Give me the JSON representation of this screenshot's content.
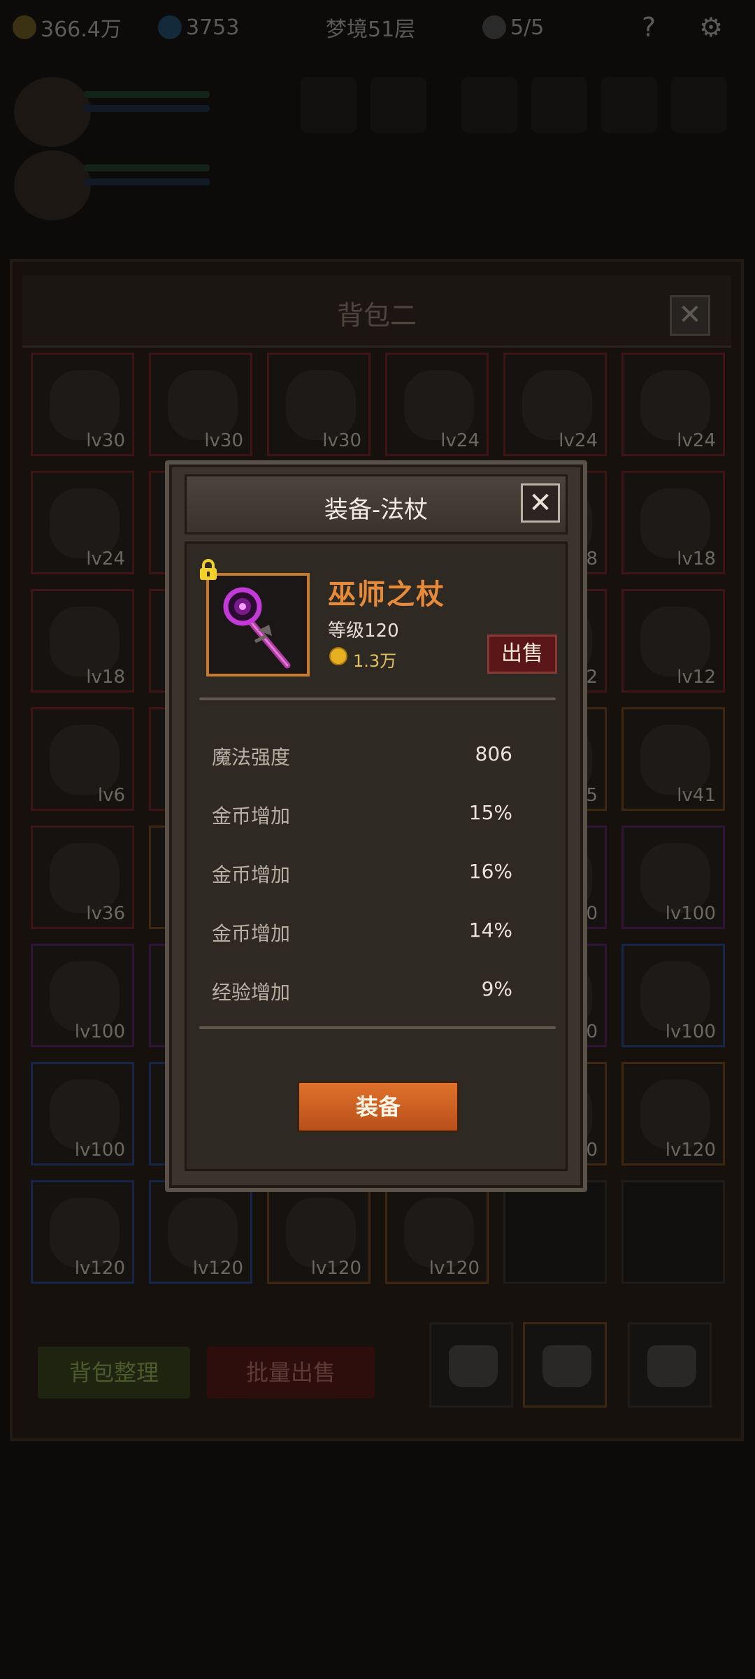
{
  "topbar": {
    "gold": "366.4万",
    "gems": "3753",
    "dream_floor": "梦境51层",
    "keys": "5/5",
    "help_icon": "question-icon",
    "settings_icon": "gear-icon"
  },
  "bag": {
    "title": "背包二",
    "close_label": "✕",
    "items": [
      {
        "level": "lv30",
        "rarity": "red"
      },
      {
        "level": "lv30",
        "rarity": "red"
      },
      {
        "level": "lv30",
        "rarity": "red"
      },
      {
        "level": "lv24",
        "rarity": "red"
      },
      {
        "level": "lv24",
        "rarity": "red"
      },
      {
        "level": "lv24",
        "rarity": "red"
      },
      {
        "level": "lv24",
        "rarity": "red"
      },
      {
        "level": "",
        "rarity": "red"
      },
      {
        "level": "",
        "rarity": "red"
      },
      {
        "level": "",
        "rarity": "red"
      },
      {
        "level": "8",
        "rarity": "red"
      },
      {
        "level": "lv18",
        "rarity": "red"
      },
      {
        "level": "lv18",
        "rarity": "red"
      },
      {
        "level": "",
        "rarity": "red"
      },
      {
        "level": "",
        "rarity": "red"
      },
      {
        "level": "",
        "rarity": "red"
      },
      {
        "level": "2",
        "rarity": "red"
      },
      {
        "level": "lv12",
        "rarity": "red"
      },
      {
        "level": "lv6",
        "rarity": "red"
      },
      {
        "level": "",
        "rarity": "red"
      },
      {
        "level": "",
        "rarity": "red"
      },
      {
        "level": "",
        "rarity": "red"
      },
      {
        "level": "5",
        "rarity": "orange"
      },
      {
        "level": "lv41",
        "rarity": "orange"
      },
      {
        "level": "lv36",
        "rarity": "red"
      },
      {
        "level": "",
        "rarity": "orange"
      },
      {
        "level": "",
        "rarity": "red"
      },
      {
        "level": "",
        "rarity": "red"
      },
      {
        "level": "00",
        "rarity": "purple"
      },
      {
        "level": "lv100",
        "rarity": "purple"
      },
      {
        "level": "lv100",
        "rarity": "purple"
      },
      {
        "level": "",
        "rarity": "purple"
      },
      {
        "level": "",
        "rarity": "purple"
      },
      {
        "level": "",
        "rarity": "purple"
      },
      {
        "level": "0",
        "rarity": "purple"
      },
      {
        "level": "lv100",
        "rarity": "blue"
      },
      {
        "level": "lv100",
        "rarity": "blue"
      },
      {
        "level": "",
        "rarity": "blue"
      },
      {
        "level": "",
        "rarity": "blue"
      },
      {
        "level": "",
        "rarity": "blue"
      },
      {
        "level": "20",
        "rarity": "orange"
      },
      {
        "level": "lv120",
        "rarity": "orange"
      },
      {
        "level": "lv120",
        "rarity": "blue"
      },
      {
        "level": "lv120",
        "rarity": "blue"
      },
      {
        "level": "lv120",
        "rarity": "orange"
      },
      {
        "level": "lv120",
        "rarity": "orange"
      },
      {
        "level": "",
        "rarity": "empty"
      },
      {
        "level": "",
        "rarity": "empty"
      }
    ],
    "organize_button": "背包整理",
    "bulk_sell_button": "批量出售"
  },
  "modal": {
    "title": "装备-法杖",
    "close_label": "✕",
    "item_name": "巫师之杖",
    "item_level": "等级120",
    "price": "1.3万",
    "sell_button": "出售",
    "stats": [
      {
        "name": "魔法强度",
        "value": "806"
      },
      {
        "name": "金币增加",
        "value": "15%"
      },
      {
        "name": "金币增加",
        "value": "16%"
      },
      {
        "name": "金币增加",
        "value": "14%"
      },
      {
        "name": "经验增加",
        "value": "9%"
      }
    ],
    "equip_button": "装备"
  },
  "colors": {
    "accent_orange": "#e78a3a",
    "equip_button": "#d0622a",
    "sell_button": "#5a1616"
  }
}
